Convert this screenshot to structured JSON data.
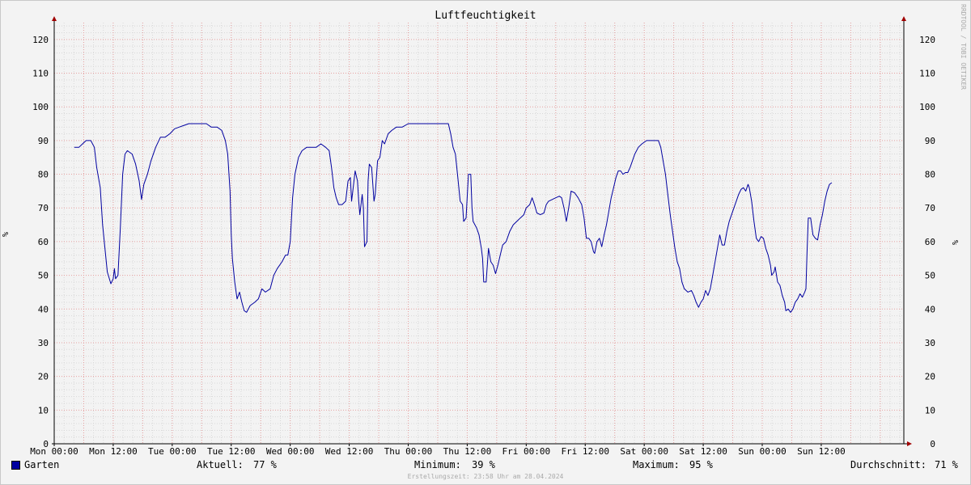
{
  "chart_data": {
    "type": "line",
    "title": "Luftfeuchtigkeit",
    "ylabel": "%",
    "ylim": [
      0,
      125
    ],
    "yticks": [
      0,
      10,
      20,
      30,
      40,
      50,
      60,
      70,
      80,
      90,
      100,
      110,
      120
    ],
    "xlim": [
      0,
      7.2
    ],
    "xticks": [
      {
        "x": 0,
        "label": "Mon 00:00"
      },
      {
        "x": 0.5,
        "label": "Mon 12:00"
      },
      {
        "x": 1,
        "label": "Tue 00:00"
      },
      {
        "x": 1.5,
        "label": "Tue 12:00"
      },
      {
        "x": 2,
        "label": "Wed 00:00"
      },
      {
        "x": 2.5,
        "label": "Wed 12:00"
      },
      {
        "x": 3,
        "label": "Thu 00:00"
      },
      {
        "x": 3.5,
        "label": "Thu 12:00"
      },
      {
        "x": 4,
        "label": "Fri 00:00"
      },
      {
        "x": 4.5,
        "label": "Fri 12:00"
      },
      {
        "x": 5,
        "label": "Sat 00:00"
      },
      {
        "x": 5.5,
        "label": "Sat 12:00"
      },
      {
        "x": 6,
        "label": "Sun 00:00"
      },
      {
        "x": 6.5,
        "label": "Sun 12:00"
      }
    ],
    "grid": true,
    "series": [
      {
        "name": "Garten",
        "color": "#0000a0",
        "points": [
          [
            0.17,
            88
          ],
          [
            0.21,
            88
          ],
          [
            0.24,
            89
          ],
          [
            0.27,
            90
          ],
          [
            0.31,
            90
          ],
          [
            0.34,
            88
          ],
          [
            0.36,
            82
          ],
          [
            0.39,
            76
          ],
          [
            0.41,
            65
          ],
          [
            0.43,
            58
          ],
          [
            0.45,
            51
          ],
          [
            0.48,
            47.5
          ],
          [
            0.5,
            49
          ],
          [
            0.51,
            52
          ],
          [
            0.52,
            49
          ],
          [
            0.54,
            50
          ],
          [
            0.56,
            64
          ],
          [
            0.58,
            80
          ],
          [
            0.6,
            86
          ],
          [
            0.62,
            87
          ],
          [
            0.66,
            86
          ],
          [
            0.69,
            83
          ],
          [
            0.72,
            78
          ],
          [
            0.74,
            72.5
          ],
          [
            0.76,
            77
          ],
          [
            0.79,
            80
          ],
          [
            0.82,
            84
          ],
          [
            0.86,
            88
          ],
          [
            0.9,
            91
          ],
          [
            0.94,
            91
          ],
          [
            0.98,
            92
          ],
          [
            1.02,
            93.5
          ],
          [
            1.06,
            94
          ],
          [
            1.1,
            94.5
          ],
          [
            1.14,
            95
          ],
          [
            1.22,
            95
          ],
          [
            1.29,
            95
          ],
          [
            1.33,
            94
          ],
          [
            1.38,
            94
          ],
          [
            1.42,
            93
          ],
          [
            1.45,
            90
          ],
          [
            1.47,
            86
          ],
          [
            1.49,
            75
          ],
          [
            1.5,
            62
          ],
          [
            1.51,
            55
          ],
          [
            1.53,
            48
          ],
          [
            1.55,
            43
          ],
          [
            1.57,
            45
          ],
          [
            1.59,
            42
          ],
          [
            1.61,
            39.5
          ],
          [
            1.63,
            39
          ],
          [
            1.66,
            41
          ],
          [
            1.7,
            42
          ],
          [
            1.73,
            43
          ],
          [
            1.76,
            46
          ],
          [
            1.79,
            45
          ],
          [
            1.83,
            46
          ],
          [
            1.86,
            50
          ],
          [
            1.89,
            52
          ],
          [
            1.93,
            54
          ],
          [
            1.96,
            56
          ],
          [
            1.98,
            56
          ],
          [
            2.0,
            60
          ],
          [
            2.02,
            73
          ],
          [
            2.04,
            80
          ],
          [
            2.07,
            85
          ],
          [
            2.1,
            87
          ],
          [
            2.14,
            88
          ],
          [
            2.18,
            88
          ],
          [
            2.22,
            88
          ],
          [
            2.26,
            89
          ],
          [
            2.3,
            88
          ],
          [
            2.33,
            87
          ],
          [
            2.35,
            82
          ],
          [
            2.37,
            76
          ],
          [
            2.39,
            73
          ],
          [
            2.41,
            71
          ],
          [
            2.44,
            71
          ],
          [
            2.47,
            72
          ],
          [
            2.49,
            78
          ],
          [
            2.51,
            79
          ],
          [
            2.52,
            72
          ],
          [
            2.53,
            75
          ],
          [
            2.55,
            81
          ],
          [
            2.57,
            78
          ],
          [
            2.58,
            72
          ],
          [
            2.59,
            68
          ],
          [
            2.61,
            74
          ],
          [
            2.62,
            70
          ],
          [
            2.63,
            58.5
          ],
          [
            2.65,
            60
          ],
          [
            2.66,
            78
          ],
          [
            2.67,
            83
          ],
          [
            2.69,
            82
          ],
          [
            2.71,
            72
          ],
          [
            2.72,
            74
          ],
          [
            2.74,
            84
          ],
          [
            2.76,
            85
          ],
          [
            2.78,
            90
          ],
          [
            2.8,
            89
          ],
          [
            2.83,
            92
          ],
          [
            2.86,
            93
          ],
          [
            2.9,
            94
          ],
          [
            2.95,
            94
          ],
          [
            3.0,
            95
          ],
          [
            3.1,
            95
          ],
          [
            3.2,
            95
          ],
          [
            3.34,
            95
          ],
          [
            3.36,
            92
          ],
          [
            3.38,
            88
          ],
          [
            3.4,
            86
          ],
          [
            3.42,
            79
          ],
          [
            3.44,
            72
          ],
          [
            3.46,
            71
          ],
          [
            3.47,
            66
          ],
          [
            3.49,
            67
          ],
          [
            3.51,
            80
          ],
          [
            3.53,
            80
          ],
          [
            3.54,
            70
          ],
          [
            3.55,
            66
          ],
          [
            3.58,
            64
          ],
          [
            3.6,
            62
          ],
          [
            3.62,
            58
          ],
          [
            3.63,
            55
          ],
          [
            3.64,
            48
          ],
          [
            3.66,
            48
          ],
          [
            3.68,
            58
          ],
          [
            3.7,
            54
          ],
          [
            3.72,
            53
          ],
          [
            3.74,
            50.5
          ],
          [
            3.76,
            53
          ],
          [
            3.78,
            56
          ],
          [
            3.8,
            59
          ],
          [
            3.83,
            60
          ],
          [
            3.86,
            63
          ],
          [
            3.89,
            65
          ],
          [
            3.92,
            66
          ],
          [
            3.95,
            67
          ],
          [
            3.98,
            68
          ],
          [
            4.0,
            70
          ],
          [
            4.03,
            71
          ],
          [
            4.05,
            73
          ],
          [
            4.07,
            71
          ],
          [
            4.09,
            68.5
          ],
          [
            4.12,
            68
          ],
          [
            4.15,
            68.5
          ],
          [
            4.17,
            71
          ],
          [
            4.19,
            72
          ],
          [
            4.22,
            72.5
          ],
          [
            4.25,
            73
          ],
          [
            4.28,
            73.5
          ],
          [
            4.3,
            73
          ],
          [
            4.32,
            70
          ],
          [
            4.34,
            66
          ],
          [
            4.36,
            70
          ],
          [
            4.38,
            75
          ],
          [
            4.41,
            74.5
          ],
          [
            4.44,
            73
          ],
          [
            4.47,
            71
          ],
          [
            4.49,
            67
          ],
          [
            4.51,
            61
          ],
          [
            4.53,
            61
          ],
          [
            4.55,
            60
          ],
          [
            4.57,
            57
          ],
          [
            4.58,
            56.5
          ],
          [
            4.6,
            60
          ],
          [
            4.62,
            61
          ],
          [
            4.64,
            58.5
          ],
          [
            4.66,
            62
          ],
          [
            4.68,
            65
          ],
          [
            4.7,
            69
          ],
          [
            4.72,
            73
          ],
          [
            4.74,
            76
          ],
          [
            4.76,
            79
          ],
          [
            4.78,
            81
          ],
          [
            4.8,
            81
          ],
          [
            4.82,
            80
          ],
          [
            4.84,
            80.5
          ],
          [
            4.86,
            80.5
          ],
          [
            4.88,
            82
          ],
          [
            4.9,
            84
          ],
          [
            4.92,
            86
          ],
          [
            4.95,
            88
          ],
          [
            4.98,
            89
          ],
          [
            5.02,
            90
          ],
          [
            5.08,
            90
          ],
          [
            5.12,
            90
          ],
          [
            5.14,
            88
          ],
          [
            5.16,
            84
          ],
          [
            5.18,
            80
          ],
          [
            5.2,
            74
          ],
          [
            5.22,
            68
          ],
          [
            5.24,
            63
          ],
          [
            5.26,
            58
          ],
          [
            5.28,
            54
          ],
          [
            5.3,
            52
          ],
          [
            5.32,
            48
          ],
          [
            5.34,
            46
          ],
          [
            5.37,
            45
          ],
          [
            5.4,
            45.5
          ],
          [
            5.42,
            44
          ],
          [
            5.44,
            42
          ],
          [
            5.46,
            40.5
          ],
          [
            5.48,
            42
          ],
          [
            5.5,
            43
          ],
          [
            5.52,
            45.5
          ],
          [
            5.54,
            44
          ],
          [
            5.56,
            46
          ],
          [
            5.58,
            50
          ],
          [
            5.6,
            54
          ],
          [
            5.62,
            58
          ],
          [
            5.64,
            62
          ],
          [
            5.66,
            59
          ],
          [
            5.68,
            59
          ],
          [
            5.7,
            63
          ],
          [
            5.72,
            66
          ],
          [
            5.74,
            68
          ],
          [
            5.76,
            70
          ],
          [
            5.78,
            72
          ],
          [
            5.8,
            74
          ],
          [
            5.82,
            75.5
          ],
          [
            5.84,
            76
          ],
          [
            5.86,
            75
          ],
          [
            5.88,
            77
          ],
          [
            5.89,
            76
          ],
          [
            5.91,
            72
          ],
          [
            5.93,
            66
          ],
          [
            5.95,
            61
          ],
          [
            5.97,
            60
          ],
          [
            5.99,
            61.5
          ],
          [
            6.01,
            61
          ],
          [
            6.03,
            58
          ],
          [
            6.05,
            56
          ],
          [
            6.07,
            53
          ],
          [
            6.08,
            50
          ],
          [
            6.1,
            51
          ],
          [
            6.11,
            52.5
          ],
          [
            6.13,
            48
          ],
          [
            6.15,
            47
          ],
          [
            6.17,
            44
          ],
          [
            6.19,
            42
          ],
          [
            6.2,
            39.5
          ],
          [
            6.22,
            40
          ],
          [
            6.24,
            39
          ],
          [
            6.26,
            40
          ],
          [
            6.28,
            42
          ],
          [
            6.3,
            43
          ],
          [
            6.32,
            44.5
          ],
          [
            6.34,
            43.5
          ],
          [
            6.36,
            45
          ],
          [
            6.37,
            46
          ],
          [
            6.38,
            57
          ],
          [
            6.39,
            67
          ],
          [
            6.41,
            67
          ],
          [
            6.43,
            62
          ],
          [
            6.45,
            61
          ],
          [
            6.47,
            60.5
          ],
          [
            6.49,
            65
          ],
          [
            6.51,
            68
          ],
          [
            6.53,
            72
          ],
          [
            6.55,
            75
          ],
          [
            6.57,
            77
          ],
          [
            6.59,
            77.5
          ]
        ]
      }
    ],
    "stats": {
      "current_label": "Aktuell:",
      "current_value": "77 %",
      "min_label": "Minimum:",
      "min_value": "39 %",
      "max_label": "Maximum:",
      "max_value": "95 %",
      "avg_label": "Durchschnitt:",
      "avg_value": "71 %"
    }
  },
  "footer": "Erstellungszeit: 23:58 Uhr am 28.04.2024",
  "vendor": "RRDTOOL / TOBI OETIKER"
}
